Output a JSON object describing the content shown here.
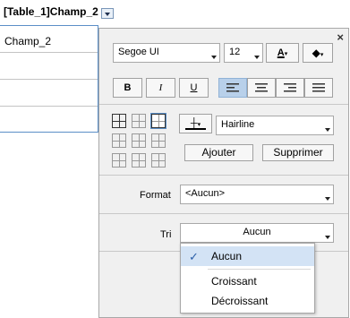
{
  "table": {
    "header": "[Table_1]Champ_2",
    "rows": [
      "Champ_2",
      "",
      "",
      ""
    ]
  },
  "panel": {
    "close": "×",
    "font": {
      "family": "Segoe UI",
      "size": "12",
      "color_label": "A"
    },
    "style_buttons": [
      "B",
      "I",
      "U"
    ],
    "border": {
      "line_style": "Hairline",
      "add": "Ajouter",
      "remove": "Supprimer"
    },
    "format": {
      "label": "Format",
      "value": "<Aucun>"
    },
    "sort": {
      "label": "Tri",
      "value": "Aucun"
    }
  },
  "sort_dropdown": {
    "options": [
      "Aucun",
      "Croissant",
      "Décroissant"
    ],
    "selected": "Aucun"
  },
  "colors": {
    "accent": "#5b8fc7",
    "selected_bg": "#d3e3f5",
    "active_btn": "#b8d0ea"
  }
}
